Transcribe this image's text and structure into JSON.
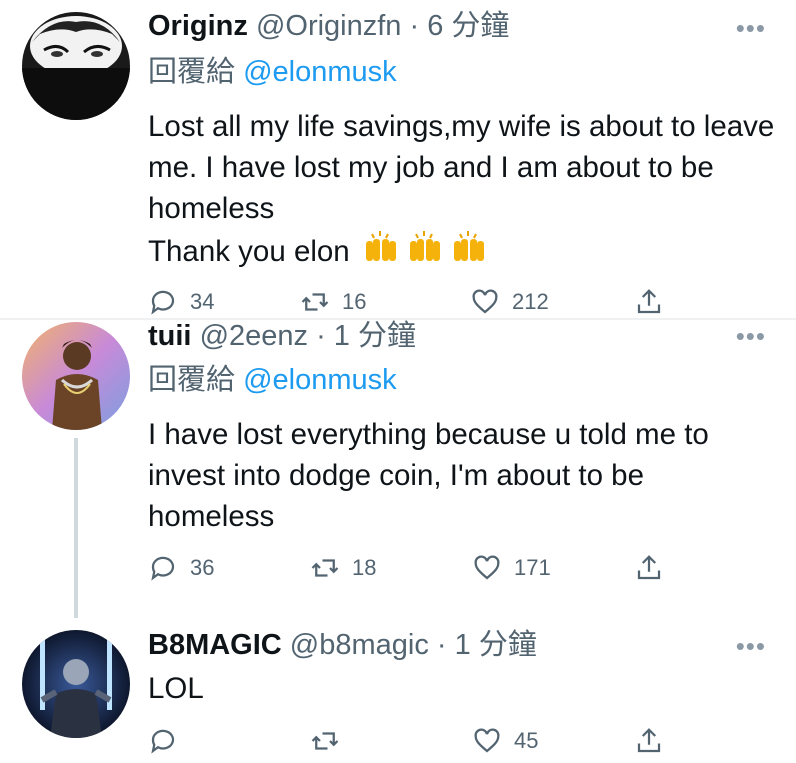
{
  "tweets": [
    {
      "name": "Originz",
      "handle": "@Originzfn",
      "time": "· 6 分鐘",
      "reply_label": "回覆給",
      "reply_handle": "@elonmusk",
      "text": "Lost all my life savings,my wife is about to leave me. I have lost my job and I am about to be homeless",
      "text2": "Thank you elon",
      "emoji": [
        "raising-hands",
        "raising-hands",
        "raising-hands"
      ],
      "replies": "34",
      "retweets": "16",
      "likes": "212"
    },
    {
      "name": "tuii",
      "handle": "@2eenz",
      "time": "· 1 分鐘",
      "reply_label": "回覆給",
      "reply_handle": "@elonmusk",
      "text": "I have lost everything because u told me to invest into dodge coin, I'm about to be homeless",
      "replies": "36",
      "retweets": "18",
      "likes": "171"
    },
    {
      "name": "B8MAGIC",
      "handle": "@b8magic",
      "time": "· 1 分鐘",
      "text": "LOL",
      "replies": "",
      "retweets": "",
      "likes": "45"
    }
  ],
  "colors": {
    "accent": "#1d9bf0",
    "secondary": "#536471",
    "text": "#0f1419"
  },
  "icons": [
    "more-icon",
    "reply-icon",
    "retweet-icon",
    "like-icon",
    "share-icon"
  ]
}
